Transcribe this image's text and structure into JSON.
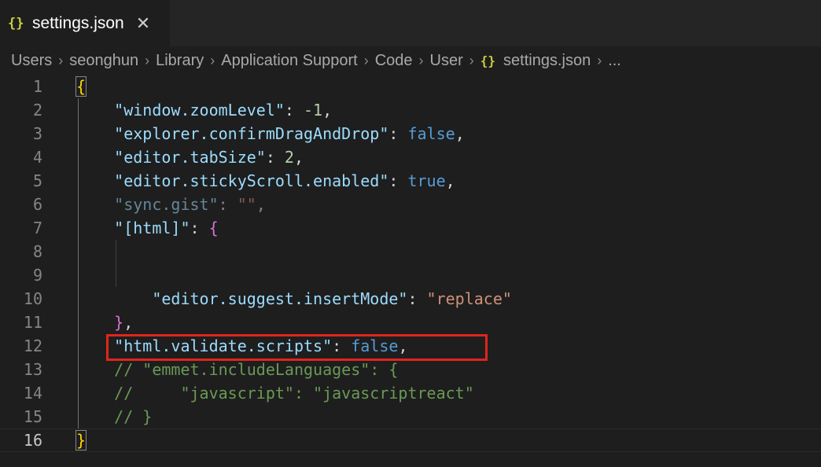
{
  "tab": {
    "icon": "{}",
    "icon_name": "json-braces-icon",
    "label": "settings.json",
    "close": "✕"
  },
  "breadcrumb": {
    "items": [
      "Users",
      "seonghun",
      "Library",
      "Application Support",
      "Code",
      "User"
    ],
    "file_icon": "{}",
    "file": "settings.json",
    "ellipsis": "...",
    "separator": "›"
  },
  "colors": {
    "key": "#9cdcfe",
    "string": "#ce9178",
    "number": "#b5cea8",
    "keyword": "#569cd6",
    "bracket_level1": "#ffd700",
    "bracket_level2": "#da70d6",
    "comment": "#6a9955",
    "highlight_box": "#e0251c"
  },
  "editor": {
    "current_line": 16,
    "highlighted_line": 12,
    "lines": [
      {
        "n": "1",
        "tokens": [
          {
            "t": "{",
            "c": "br1"
          }
        ]
      },
      {
        "n": "2",
        "tokens": [
          {
            "t": "    ",
            "c": "punc"
          },
          {
            "t": "\"window.zoomLevel\"",
            "c": "key"
          },
          {
            "t": ": ",
            "c": "punc"
          },
          {
            "t": "-1",
            "c": "num"
          },
          {
            "t": ",",
            "c": "punc"
          }
        ]
      },
      {
        "n": "3",
        "tokens": [
          {
            "t": "    ",
            "c": "punc"
          },
          {
            "t": "\"explorer.confirmDragAndDrop\"",
            "c": "key"
          },
          {
            "t": ": ",
            "c": "punc"
          },
          {
            "t": "false",
            "c": "kw"
          },
          {
            "t": ",",
            "c": "punc"
          }
        ]
      },
      {
        "n": "4",
        "tokens": [
          {
            "t": "    ",
            "c": "punc"
          },
          {
            "t": "\"editor.tabSize\"",
            "c": "key"
          },
          {
            "t": ": ",
            "c": "punc"
          },
          {
            "t": "2",
            "c": "num"
          },
          {
            "t": ",",
            "c": "punc"
          }
        ]
      },
      {
        "n": "5",
        "tokens": [
          {
            "t": "    ",
            "c": "punc"
          },
          {
            "t": "\"editor.stickyScroll.enabled\"",
            "c": "key"
          },
          {
            "t": ": ",
            "c": "punc"
          },
          {
            "t": "true",
            "c": "kw"
          },
          {
            "t": ",",
            "c": "punc"
          }
        ]
      },
      {
        "n": "6",
        "tokens": [
          {
            "t": "    ",
            "c": "punc"
          },
          {
            "t": "\"sync.gist\"",
            "c": "key dim"
          },
          {
            "t": ": ",
            "c": "punc dim"
          },
          {
            "t": "\"\"",
            "c": "str dim"
          },
          {
            "t": ",",
            "c": "punc dim"
          }
        ]
      },
      {
        "n": "7",
        "tokens": [
          {
            "t": "    ",
            "c": "punc"
          },
          {
            "t": "\"[html]\"",
            "c": "key"
          },
          {
            "t": ": ",
            "c": "punc"
          },
          {
            "t": "{",
            "c": "br2"
          }
        ]
      },
      {
        "n": "8",
        "tokens": []
      },
      {
        "n": "9",
        "tokens": []
      },
      {
        "n": "10",
        "tokens": [
          {
            "t": "        ",
            "c": "punc"
          },
          {
            "t": "\"editor.suggest.insertMode\"",
            "c": "key"
          },
          {
            "t": ": ",
            "c": "punc"
          },
          {
            "t": "\"replace\"",
            "c": "str"
          }
        ]
      },
      {
        "n": "11",
        "tokens": [
          {
            "t": "    ",
            "c": "punc"
          },
          {
            "t": "}",
            "c": "br2"
          },
          {
            "t": ",",
            "c": "punc"
          }
        ]
      },
      {
        "n": "12",
        "tokens": [
          {
            "t": "    ",
            "c": "punc"
          },
          {
            "t": "\"html.validate.scripts\"",
            "c": "key"
          },
          {
            "t": ": ",
            "c": "punc"
          },
          {
            "t": "false",
            "c": "kw"
          },
          {
            "t": ",",
            "c": "punc"
          }
        ]
      },
      {
        "n": "13",
        "tokens": [
          {
            "t": "    ",
            "c": "punc"
          },
          {
            "t": "// \"emmet.includeLanguages\": {",
            "c": "cm"
          }
        ]
      },
      {
        "n": "14",
        "tokens": [
          {
            "t": "    ",
            "c": "punc"
          },
          {
            "t": "//     \"javascript\": \"javascriptreact\"",
            "c": "cm"
          }
        ]
      },
      {
        "n": "15",
        "tokens": [
          {
            "t": "    ",
            "c": "punc"
          },
          {
            "t": "// }",
            "c": "cm"
          }
        ]
      },
      {
        "n": "16",
        "tokens": [
          {
            "t": "}",
            "c": "br1"
          }
        ]
      }
    ]
  }
}
